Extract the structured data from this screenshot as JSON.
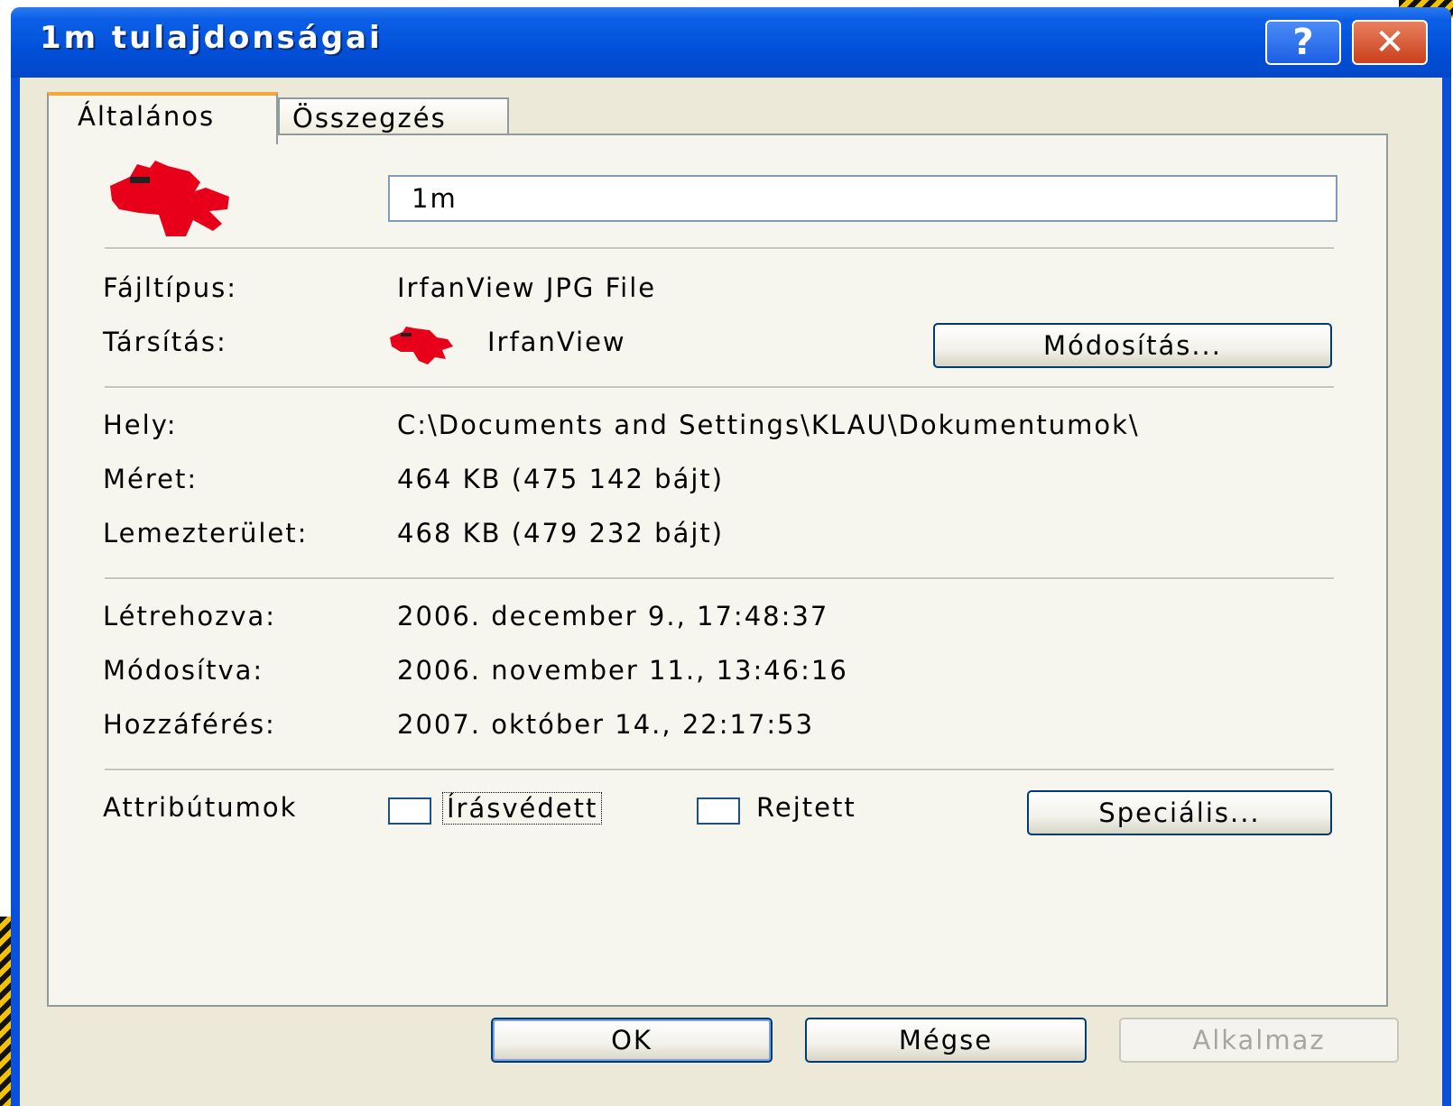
{
  "window": {
    "title": "1m tulajdonságai",
    "help_label": "?",
    "close_label": "✕"
  },
  "tabs": [
    {
      "label": "Általános",
      "active": true
    },
    {
      "label": "Összegzés",
      "active": false
    }
  ],
  "general": {
    "file_icon": "irfanview-icon",
    "file_name": "1m",
    "type_label": "Fájltípus:",
    "type_value": "IrfanView JPG File",
    "opens_label": "Társítás:",
    "opens_value": "IrfanView",
    "change_button": "Módosítás...",
    "location_label": "Hely:",
    "location_value": "C:\\Documents and Settings\\KLAU\\Dokumentumok\\",
    "size_label": "Méret:",
    "size_value": "464 KB (475 142 bájt)",
    "disk_label": "Lemezterület:",
    "disk_value": "468 KB (479 232 bájt)",
    "created_label": "Létrehozva:",
    "created_value": "2006. december 9., 17:48:37",
    "modified_label": "Módosítva:",
    "modified_value": "2006. november 11., 13:46:16",
    "accessed_label": "Hozzáférés:",
    "accessed_value": "2007. október 14., 22:17:53",
    "attributes_label": "Attribútumok",
    "readonly_label": "Írásvédett",
    "readonly_checked": false,
    "hidden_label": "Rejtett",
    "hidden_checked": false,
    "advanced_button": "Speciális..."
  },
  "footer": {
    "ok": "OK",
    "cancel": "Mégse",
    "apply": "Alkalmaz"
  },
  "colors": {
    "titlebar": "#0250d9",
    "accent_tab": "#f7a63c",
    "icon_red": "#e8001a"
  }
}
